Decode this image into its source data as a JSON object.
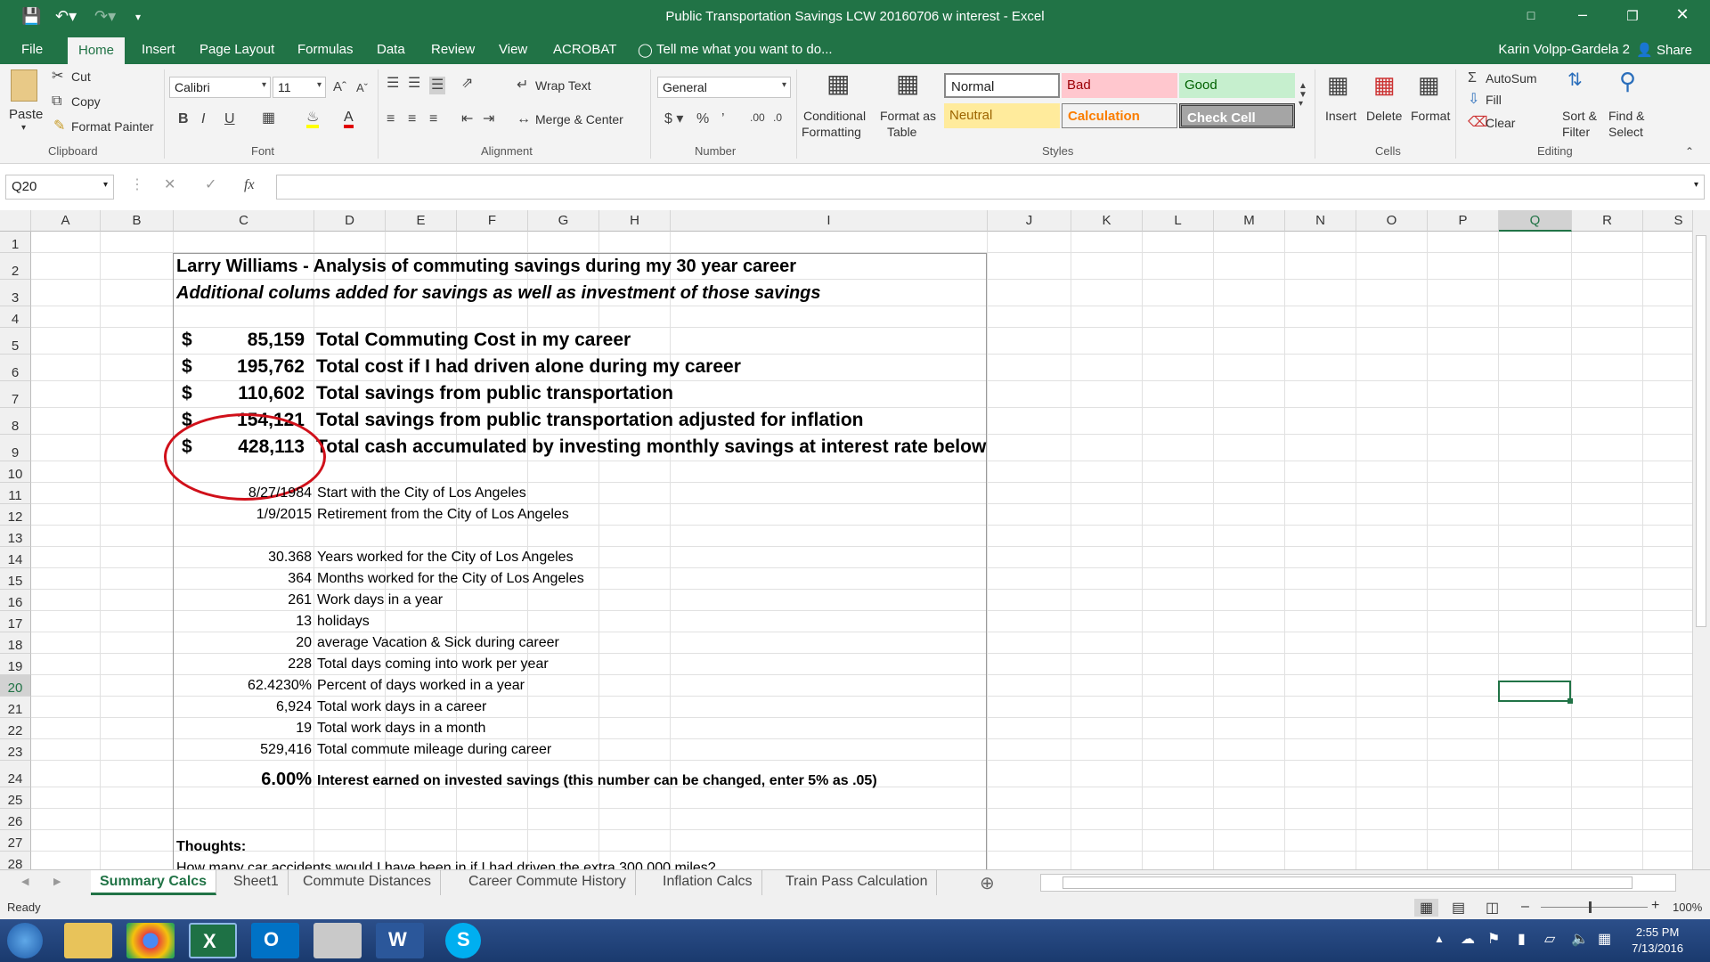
{
  "window": {
    "title": "Public Transportation Savings LCW 20160706 w interest - Excel"
  },
  "tabs": [
    "File",
    "Home",
    "Insert",
    "Page Layout",
    "Formulas",
    "Data",
    "Review",
    "View",
    "ACROBAT"
  ],
  "tell_me": "Tell me what you want to do...",
  "user": "Karin Volpp-Gardela 2",
  "share": "Share",
  "ribbon": {
    "clipboard": {
      "paste": "Paste",
      "cut": "Cut",
      "copy": "Copy",
      "format_painter": "Format Painter",
      "label": "Clipboard"
    },
    "font": {
      "name": "Calibri",
      "size": "11",
      "label": "Font"
    },
    "alignment": {
      "wrap_text": "Wrap Text",
      "merge_center": "Merge & Center",
      "label": "Alignment"
    },
    "number": {
      "format": "General",
      "label": "Number"
    },
    "styles": {
      "conditional_1": "Conditional",
      "conditional_2": "Formatting",
      "format_as_1": "Format as",
      "format_as_2": "Table",
      "normal": "Normal",
      "bad": "Bad",
      "good": "Good",
      "neutral": "Neutral",
      "calculation": "Calculation",
      "check_cell": "Check Cell",
      "label": "Styles"
    },
    "cells": {
      "insert": "Insert",
      "delete": "Delete",
      "format": "Format",
      "label": "Cells"
    },
    "editing": {
      "autosum": "AutoSum",
      "fill": "Fill",
      "clear": "Clear",
      "sort_1": "Sort &",
      "sort_2": "Filter",
      "find_1": "Find &",
      "find_2": "Select",
      "label": "Editing"
    }
  },
  "formula_bar": {
    "name_box": "Q20",
    "fx": "fx",
    "content": ""
  },
  "columns": [
    "A",
    "B",
    "C",
    "D",
    "E",
    "F",
    "G",
    "H",
    "I",
    "J",
    "K",
    "L",
    "M",
    "N",
    "O",
    "P",
    "Q",
    "R",
    "S"
  ],
  "rows": [
    "1",
    "2",
    "3",
    "4",
    "5",
    "6",
    "7",
    "8",
    "9",
    "10",
    "11",
    "12",
    "13",
    "14",
    "15",
    "16",
    "17",
    "18",
    "19",
    "20",
    "21",
    "22",
    "23",
    "24",
    "25",
    "26",
    "27",
    "28"
  ],
  "sheet": {
    "title": "Larry Williams - Analysis of commuting savings during my 30 year career",
    "subtitle": "Additional colums added for savings as well as investment of those savings",
    "summary": [
      {
        "currency": "$",
        "value": "85,159",
        "label": "Total Commuting Cost in my career"
      },
      {
        "currency": "$",
        "value": "195,762",
        "label": "Total cost if I had driven alone during my career"
      },
      {
        "currency": "$",
        "value": "110,602",
        "label": "Total savings from public transportation"
      },
      {
        "currency": "$",
        "value": "154,121",
        "label": "Total savings from public transportation adjusted for inflation"
      },
      {
        "currency": "$",
        "value": "428,113",
        "label": "Total cash accumulated by investing monthly savings at interest rate below"
      }
    ],
    "details": [
      {
        "row": 11,
        "value": "8/27/1984",
        "label": "Start with the City of Los Angeles"
      },
      {
        "row": 12,
        "value": "1/9/2015",
        "label": "Retirement from the City of Los Angeles"
      },
      {
        "row": 14,
        "value": "30.368",
        "label": "Years worked for the City of Los Angeles"
      },
      {
        "row": 15,
        "value": "364",
        "label": "Months worked for the City of Los Angeles"
      },
      {
        "row": 16,
        "value": "261",
        "label": "Work days in a year"
      },
      {
        "row": 17,
        "value": "13",
        "label": "holidays"
      },
      {
        "row": 18,
        "value": "20",
        "label": "average Vacation & Sick during career"
      },
      {
        "row": 19,
        "value": "228",
        "label": "Total days coming into work per year"
      },
      {
        "row": 20,
        "value": "62.4230%",
        "label": "Percent of days worked in a year"
      },
      {
        "row": 21,
        "value": "6,924",
        "label": "Total work days in a career"
      },
      {
        "row": 22,
        "value": "19",
        "label": "Total work days in a month"
      },
      {
        "row": 23,
        "value": "529,416",
        "label": "Total commute mileage during career"
      }
    ],
    "interest": {
      "value": "6.00%",
      "label": "Interest earned on invested savings (this number can be changed, enter 5% as .05)"
    },
    "thoughts": "Thoughts:",
    "row28_partial": "How many car accidents would I have been in if I had driven the extra 300,000 miles?"
  },
  "sheet_tabs": [
    "Summary Calcs",
    "Sheet1",
    "Commute Distances",
    "Career Commute History",
    "Inflation Calcs",
    "Train Pass Calculation"
  ],
  "status": {
    "ready": "Ready",
    "zoom": "100%"
  },
  "clock": {
    "time": "2:55 PM",
    "date": "7/13/2016"
  }
}
